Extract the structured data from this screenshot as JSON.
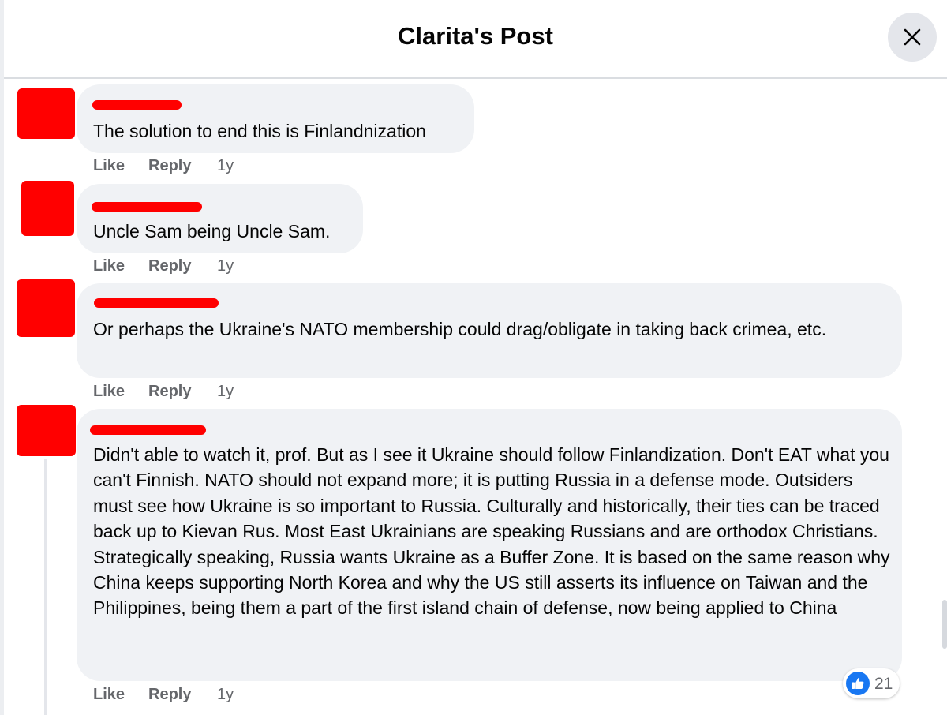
{
  "header": {
    "title": "Clarita's Post"
  },
  "icons": {
    "close": "close-icon",
    "like_reaction": "like-reaction-icon"
  },
  "colors": {
    "bubble": "#f0f2f5",
    "redaction": "#ff0000",
    "like_blue": "#1877f2",
    "muted": "#65676b"
  },
  "comments": [
    {
      "text": "The solution to end this is Finlandnization",
      "like": "Like",
      "reply": "Reply",
      "time": "1y"
    },
    {
      "text": "Uncle Sam being Uncle Sam.",
      "like": "Like",
      "reply": "Reply",
      "time": "1y"
    },
    {
      "text": "Or perhaps the Ukraine's NATO membership could drag/obligate in taking back crimea, etc.",
      "like": "Like",
      "reply": "Reply",
      "time": "1y"
    },
    {
      "text": "Didn't able to watch it, prof. But as I see it Ukraine should follow Finlandization. Don't EAT what you can't Finnish. NATO should not expand more; it is putting Russia in a defense mode. Outsiders must see how Ukraine is so important to Russia. Culturally and historically, their ties can be traced back up to Kievan Rus. Most East Ukrainians are speaking Russians and are orthodox Christians.\nStrategically speaking, Russia wants Ukraine as a Buffer Zone. It is based on the same reason why China keeps supporting North Korea and why the US still asserts its influence on Taiwan and the Philippines, being them a part of the first island chain of defense, now being applied to China",
      "like": "Like",
      "reply": "Reply",
      "time": "1y",
      "reaction_count": "21"
    }
  ]
}
